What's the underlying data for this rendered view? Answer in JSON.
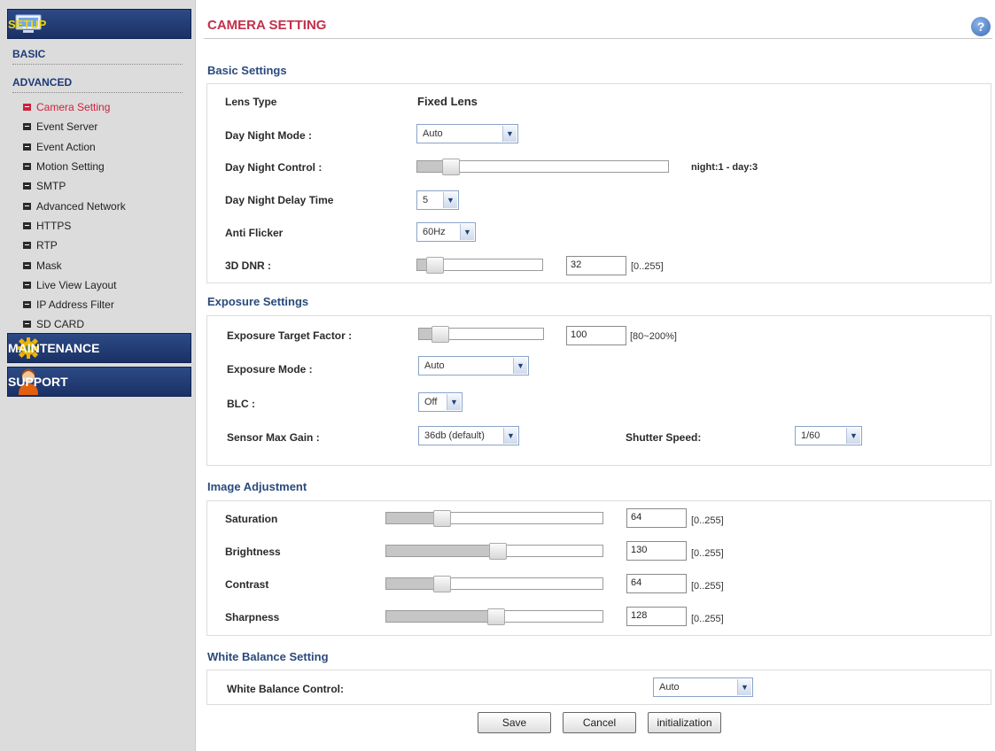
{
  "sidebar": {
    "setup_label": "SETUP",
    "basic_label": "BASIC",
    "advanced_label": "ADVANCED",
    "items": [
      {
        "label": "Camera Setting",
        "active": true
      },
      {
        "label": "Event Server"
      },
      {
        "label": "Event Action"
      },
      {
        "label": "Motion Setting"
      },
      {
        "label": "SMTP"
      },
      {
        "label": "Advanced Network"
      },
      {
        "label": "HTTPS"
      },
      {
        "label": "RTP"
      },
      {
        "label": "Mask"
      },
      {
        "label": "Live View Layout"
      },
      {
        "label": "IP Address Filter"
      },
      {
        "label": "SD CARD"
      }
    ],
    "maintenance_label": "MAINTENANCE",
    "support_label": "SUPPORT"
  },
  "header": {
    "title": "CAMERA SETTING",
    "help_icon": "?"
  },
  "basic": {
    "title": "Basic Settings",
    "lens_type_label": "Lens Type",
    "lens_type_value": "Fixed Lens",
    "day_night_mode_label": "Day Night Mode :",
    "day_night_mode_value": "Auto",
    "day_night_control_label": "Day Night Control :",
    "day_night_control_value": "night:1 - day:3",
    "day_night_delay_label": "Day Night Delay Time",
    "day_night_delay_value": "5",
    "anti_flicker_label": "Anti Flicker",
    "anti_flicker_value": "60Hz",
    "dnr_label": "3D DNR :",
    "dnr_value": "32",
    "dnr_range": "[0..255]"
  },
  "exposure": {
    "title": "Exposure Settings",
    "target_label": "Exposure Target Factor :",
    "target_value": "100",
    "target_range": "[80~200%]",
    "mode_label": "Exposure Mode :",
    "mode_value": "Auto",
    "blc_label": "BLC :",
    "blc_value": "Off",
    "gain_label": "Sensor Max Gain :",
    "gain_value": "36db (default)",
    "shutter_label": "Shutter Speed:",
    "shutter_value": "1/60"
  },
  "image": {
    "title": "Image Adjustment",
    "rows": [
      {
        "label": "Saturation",
        "value": "64",
        "range": "[0..255]"
      },
      {
        "label": "Brightness",
        "value": "130",
        "range": "[0..255]"
      },
      {
        "label": "Contrast",
        "value": "64",
        "range": "[0..255]"
      },
      {
        "label": "Sharpness",
        "value": "128",
        "range": "[0..255]"
      }
    ]
  },
  "white_balance": {
    "title": "White Balance Setting",
    "control_label": "White Balance Control:",
    "control_value": "Auto"
  },
  "buttons": {
    "save": "Save",
    "cancel": "Cancel",
    "init": "initialization"
  }
}
